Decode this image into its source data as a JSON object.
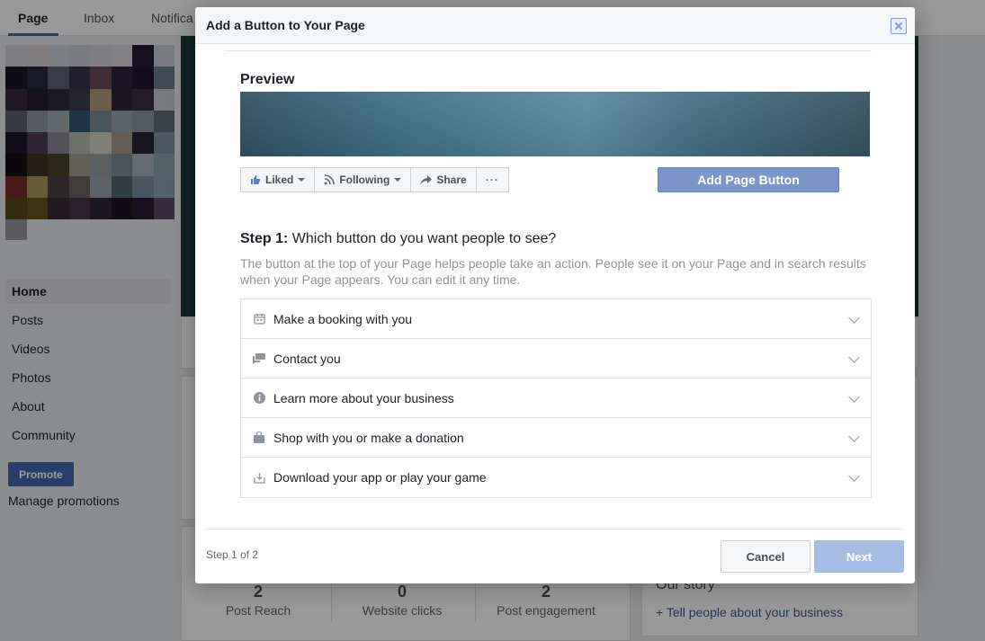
{
  "topnav": {
    "tabs": [
      {
        "label": "Page"
      },
      {
        "label": "Inbox"
      },
      {
        "label": "Notifica"
      }
    ]
  },
  "leftnav": {
    "items": [
      {
        "label": "Home"
      },
      {
        "label": "Posts"
      },
      {
        "label": "Videos"
      },
      {
        "label": "Photos"
      },
      {
        "label": "About"
      },
      {
        "label": "Community"
      }
    ],
    "promote_label": "Promote",
    "manage_label": "Manage promotions"
  },
  "stats": [
    {
      "value": "2",
      "label": "Post Reach"
    },
    {
      "value": "0",
      "label": "Website clicks"
    },
    {
      "value": "2",
      "label": "Post engagement"
    }
  ],
  "story": {
    "title": "Our story",
    "link": "+ Tell people about your business"
  },
  "dialog": {
    "title": "Add a Button to Your Page",
    "preview_label": "Preview",
    "preview_buttons": [
      {
        "label": "Liked",
        "icon": "like-icon"
      },
      {
        "label": "Following",
        "icon": "rss-icon"
      },
      {
        "label": "Share",
        "icon": "share-arrow-icon"
      },
      {
        "label": "···",
        "icon": "more-icon"
      }
    ],
    "add_page_button": "Add Page Button",
    "step_title_prefix": "Step 1:",
    "step_title": "Which button do you want people to see?",
    "step_desc": "The button at the top of your Page helps people take an action. People see it on your Page and in search results when your Page appears. You can edit it any time.",
    "options": [
      {
        "label": "Make a booking with you",
        "icon": "calendar-icon"
      },
      {
        "label": "Contact you",
        "icon": "chat-icon"
      },
      {
        "label": "Learn more about your business",
        "icon": "info-icon"
      },
      {
        "label": "Shop with you or make a donation",
        "icon": "shopping-bag-icon"
      },
      {
        "label": "Download your app or play your game",
        "icon": "download-icon"
      }
    ],
    "step_count": "Step 1 of 2",
    "cancel_label": "Cancel",
    "next_label": "Next"
  },
  "colors": {
    "accent": "#4267b2",
    "add_button": "#7c95c9",
    "next_disabled": "#a6bde6",
    "overlay": "rgba(0,0,0,0.40)"
  }
}
